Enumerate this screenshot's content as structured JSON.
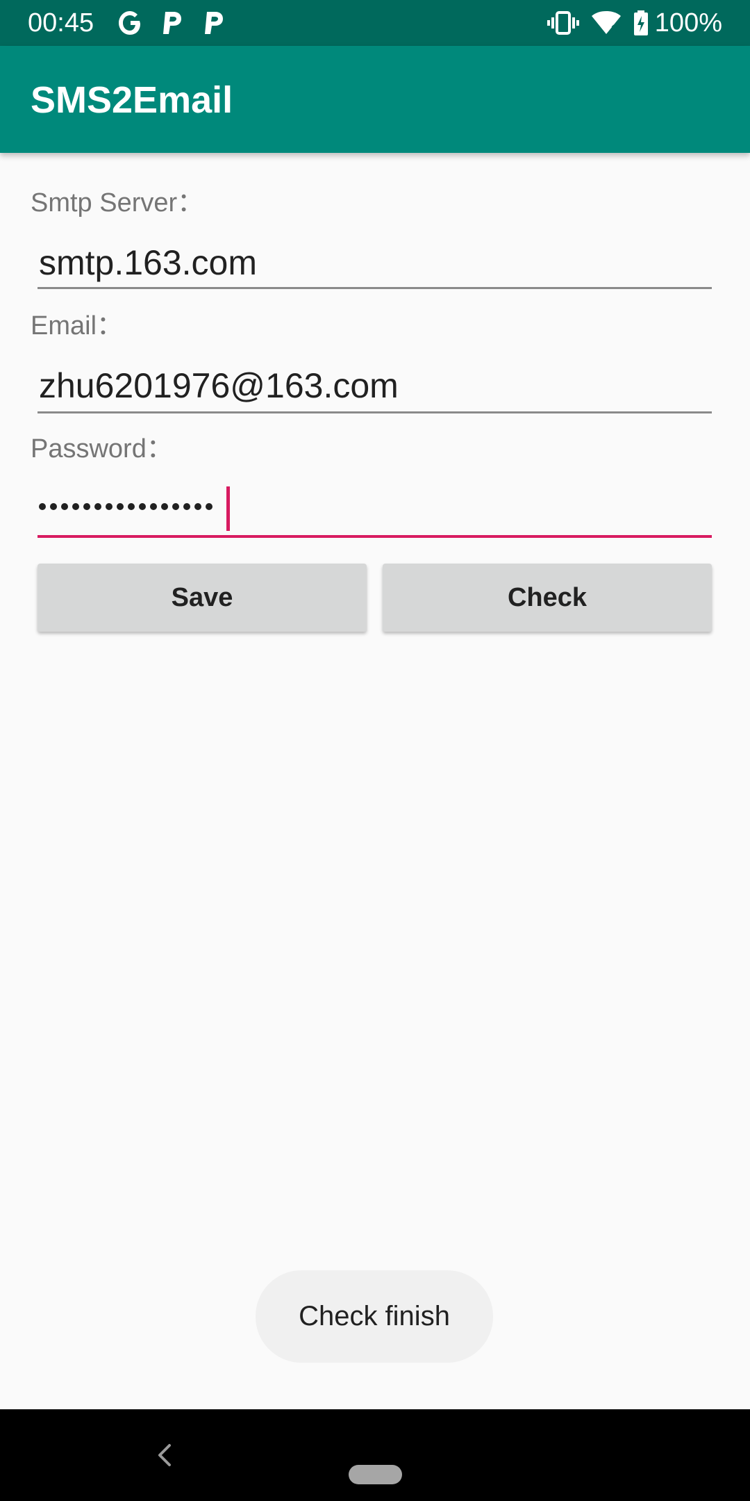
{
  "status_bar": {
    "time": "00:45",
    "battery": "100%",
    "icons": [
      "google-icon",
      "parking-icon",
      "parking-icon",
      "vibrate-icon",
      "wifi-icon",
      "battery-charging-icon"
    ]
  },
  "app_bar": {
    "title": "SMS2Email"
  },
  "form": {
    "smtp_label": "Smtp Server：",
    "smtp_value": "smtp.163.com",
    "email_label": "Email：",
    "email_value": "zhu6201976@163.com",
    "password_label": "Password：",
    "password_length": 16
  },
  "buttons": {
    "save": "Save",
    "check": "Check"
  },
  "toast": {
    "message": "Check finish"
  },
  "colors": {
    "status_bar": "#00695c",
    "app_bar": "#00897b",
    "accent": "#d81b60",
    "button": "#d6d7d7",
    "background": "#fafafa"
  }
}
